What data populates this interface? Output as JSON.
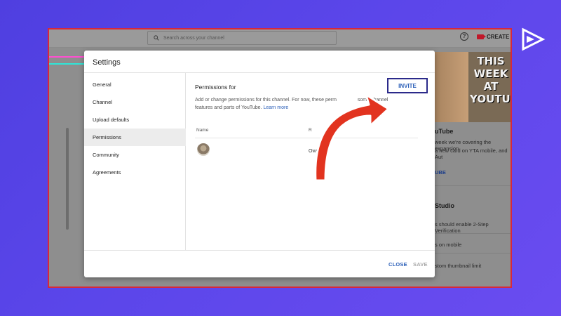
{
  "youtube": {
    "search_placeholder": "Search across your channel",
    "create_label": "CREATE",
    "help_glyph": "?",
    "thumbnail_text": "THIS WEEK AT YOUTUB",
    "side_panel": {
      "video_title": "uTube",
      "video_desc_line1": "week we're covering the expansion",
      "video_desc_line2": "a new card on YTA mobile, and Aut",
      "video_link": "UBE",
      "studio_title": "Studio",
      "items": [
        "s should enable 2-Step Verification",
        "s on mobile",
        "stom thumbnail limit"
      ]
    }
  },
  "dialog": {
    "title": "Settings",
    "nav": [
      {
        "label": "General"
      },
      {
        "label": "Channel"
      },
      {
        "label": "Upload defaults"
      },
      {
        "label": "Permissions"
      },
      {
        "label": "Community"
      },
      {
        "label": "Agreements"
      }
    ],
    "active_nav": "Permissions",
    "content": {
      "title": "Permissions for",
      "desc_line1": "Add or change permissions for this channel. For now, these perm",
      "desc_line1_tail": "some channel",
      "desc_line2": "features and parts of YouTube.",
      "learn_more": "Learn more",
      "invite_label": "INVITE",
      "columns": {
        "name": "Name",
        "role": "R"
      },
      "rows": [
        {
          "role": "Owner"
        }
      ]
    },
    "footer": {
      "close_label": "CLOSE",
      "save_label": "SAVE"
    }
  },
  "colors": {
    "background": "#5b46ea",
    "frame_border": "#d8283a",
    "link_blue": "#2b5fb8",
    "highlight_box": "#2b2a8a",
    "arrow_red": "#e2331f"
  },
  "icons": [
    "brand-logo-icon",
    "search-icon",
    "help-icon",
    "video-camera-icon",
    "red-arrow-icon"
  ]
}
